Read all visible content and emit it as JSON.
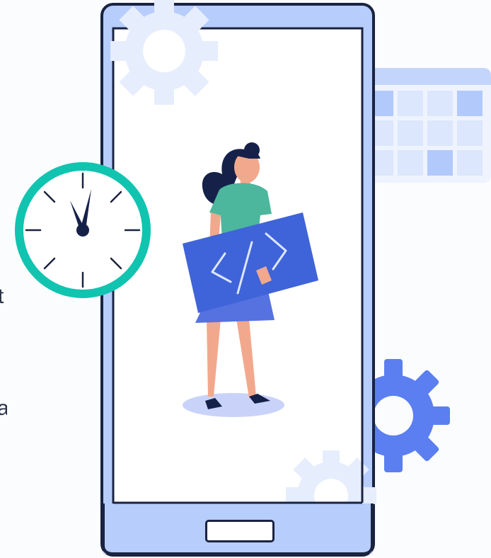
{
  "edge_text": {
    "line_1": "t",
    "line_2": "a"
  },
  "colors": {
    "phone_body": "#b7cdfb",
    "phone_outline": "#1a2340",
    "screen": "#ffffff",
    "clock_ring": "#10c4b0",
    "calendar_header": "#c3d5fb",
    "calendar_cell": "#dce7fd",
    "calendar_highlight": "#b2c9fb",
    "code_board": "#3f63d9",
    "gear_accent": "#5b7ff0",
    "gear_faint": "#e6edfc",
    "shirt": "#4cb79c",
    "skirt": "#5572e0",
    "skin": "#f2a88c",
    "hair": "#16214a"
  },
  "icons": [
    "clock-icon",
    "calendar-icon",
    "gear-icon",
    "code-icon",
    "home-button"
  ]
}
